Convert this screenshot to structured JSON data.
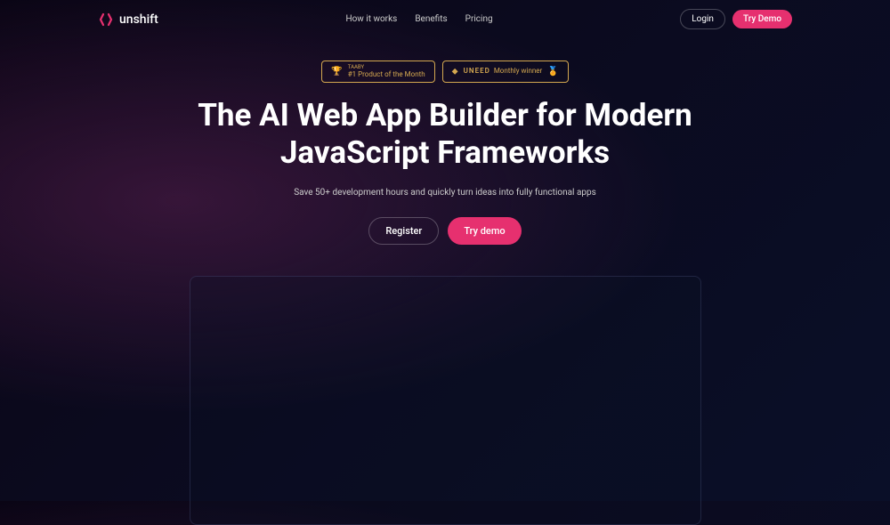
{
  "brand": {
    "name": "unshift"
  },
  "nav": {
    "items": [
      "How it works",
      "Benefits",
      "Pricing"
    ]
  },
  "header": {
    "login": "Login",
    "tryDemo": "Try Demo"
  },
  "badges": [
    {
      "label": "TAABY",
      "title": "#1 Product of the Month"
    },
    {
      "brand": "UNEED",
      "title": "Monthly winner"
    }
  ],
  "hero": {
    "title": "The AI Web App Builder for Modern JavaScript Frameworks",
    "subtitle": "Save 50+ development hours and quickly turn ideas into fully functional apps",
    "register": "Register",
    "tryDemo": "Try demo"
  }
}
